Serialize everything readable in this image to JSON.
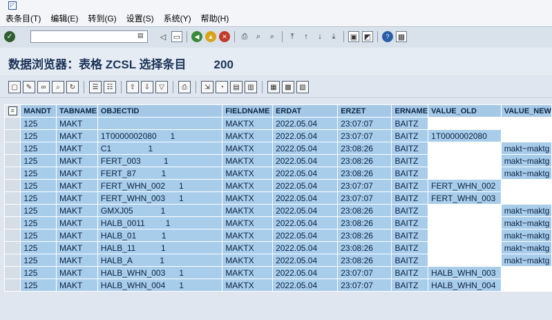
{
  "menu": [
    "表条目(T)",
    "编辑(E)",
    "转到(G)",
    "设置(S)",
    "系统(Y)",
    "帮助(H)"
  ],
  "title": "数据浏览器：表格 ZCSL 选择条目",
  "entry_count": "200",
  "columns": [
    "MANDT",
    "TABNAME",
    "OBJECTID",
    "FIELDNAME",
    "ERDAT",
    "ERZET",
    "ERNAME",
    "VALUE_OLD",
    "VALUE_NEW"
  ],
  "rows": [
    [
      "125",
      "MAKT",
      "",
      "MAKTX",
      "2022.05.04",
      "23:07:07",
      "BAITZ",
      "",
      ""
    ],
    [
      "125",
      "MAKT",
      "1T0000002080      1",
      "MAKTX",
      "2022.05.04",
      "23:07:07",
      "BAITZ",
      "1T0000002080",
      ""
    ],
    [
      "125",
      "MAKT",
      "C1                1",
      "MAKTX",
      "2022.05.04",
      "23:08:26",
      "BAITZ",
      "",
      "makt~maktg"
    ],
    [
      "125",
      "MAKT",
      "FERT_003          1",
      "MAKTX",
      "2022.05.04",
      "23:08:26",
      "BAITZ",
      "",
      "makt~maktg"
    ],
    [
      "125",
      "MAKT",
      "FERT_87           1",
      "MAKTX",
      "2022.05.04",
      "23:08:26",
      "BAITZ",
      "",
      "makt~maktg"
    ],
    [
      "125",
      "MAKT",
      "FERT_WHN_002      1",
      "MAKTX",
      "2022.05.04",
      "23:07:07",
      "BAITZ",
      "FERT_WHN_002",
      ""
    ],
    [
      "125",
      "MAKT",
      "FERT_WHN_003      1",
      "MAKTX",
      "2022.05.04",
      "23:07:07",
      "BAITZ",
      "FERT_WHN_003",
      ""
    ],
    [
      "125",
      "MAKT",
      "GMXJ05            1",
      "MAKTX",
      "2022.05.04",
      "23:08:26",
      "BAITZ",
      "",
      "makt~maktg"
    ],
    [
      "125",
      "MAKT",
      "HALB_0011         1",
      "MAKTX",
      "2022.05.04",
      "23:08:26",
      "BAITZ",
      "",
      "makt~maktg"
    ],
    [
      "125",
      "MAKT",
      "HALB_01           1",
      "MAKTX",
      "2022.05.04",
      "23:08:26",
      "BAITZ",
      "",
      "makt~maktg"
    ],
    [
      "125",
      "MAKT",
      "HALB_11           1",
      "MAKTX",
      "2022.05.04",
      "23:08:26",
      "BAITZ",
      "",
      "makt~maktg"
    ],
    [
      "125",
      "MAKT",
      "HALB_A            1",
      "MAKTX",
      "2022.05.04",
      "23:08:26",
      "BAITZ",
      "",
      "makt~maktg"
    ],
    [
      "125",
      "MAKT",
      "HALB_WHN_003      1",
      "MAKTX",
      "2022.05.04",
      "23:07:07",
      "BAITZ",
      "HALB_WHN_003",
      ""
    ],
    [
      "125",
      "MAKT",
      "HALB_WHN_004      1",
      "MAKTX",
      "2022.05.04",
      "23:07:07",
      "BAITZ",
      "HALB_WHN_004",
      ""
    ]
  ],
  "colors": {
    "cell_blue": "#a8cdeb",
    "header_blue": "#a6c8e7",
    "title_text": "#1b3358"
  }
}
